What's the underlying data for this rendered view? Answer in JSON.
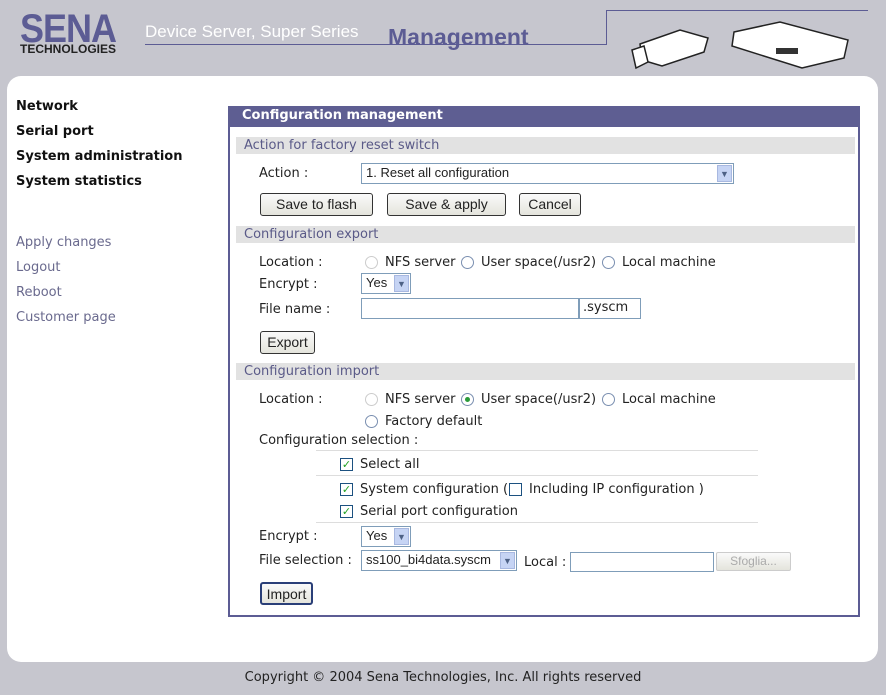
{
  "header": {
    "logo_main": "SENA",
    "logo_sub": "TECHNOLOGIES",
    "subtitle": "Device Server, Super Series",
    "title": "Management"
  },
  "sidebar": {
    "menu": [
      {
        "label": "Network"
      },
      {
        "label": "Serial port"
      },
      {
        "label": "System administration"
      },
      {
        "label": "System statistics"
      }
    ],
    "links": [
      {
        "label": "Apply changes"
      },
      {
        "label": "Logout"
      },
      {
        "label": "Reboot"
      },
      {
        "label": "Customer page"
      }
    ]
  },
  "panel": {
    "title": "Configuration management",
    "reset": {
      "heading": "Action for factory reset switch",
      "action_label": "Action :",
      "action_value": "1. Reset all configuration",
      "save_flash": "Save to flash",
      "save_apply": "Save & apply",
      "cancel": "Cancel"
    },
    "export": {
      "heading": "Configuration export",
      "location_label": "Location :",
      "opt_nfs": "NFS server",
      "opt_user": "User space(/usr2)",
      "opt_local": "Local machine",
      "encrypt_label": "Encrypt :",
      "encrypt_value": "Yes",
      "filename_label": "File name :",
      "filename_value": "",
      "ext": ".syscm",
      "export_btn": "Export"
    },
    "import": {
      "heading": "Configuration import",
      "location_label": "Location :",
      "opt_nfs": "NFS server",
      "opt_user": "User space(/usr2)",
      "opt_local": "Local machine",
      "opt_factory": "Factory default",
      "selected_location": "User space(/usr2)",
      "selection_label": "Configuration selection :",
      "select_all": "Select all",
      "system_config": "System configuration (",
      "including_ip": "Including IP configuration )",
      "serial_config": "Serial port configuration",
      "encrypt_label": "Encrypt :",
      "encrypt_value": "Yes",
      "file_label": "File selection :",
      "file_value": "ss100_bi4data.syscm",
      "local_label": "Local :",
      "local_value": "",
      "browse": "Sfoglia...",
      "import_btn": "Import"
    }
  },
  "footer": {
    "copyright": "Copyright © 2004 Sena Technologies, Inc. All rights reserved"
  }
}
